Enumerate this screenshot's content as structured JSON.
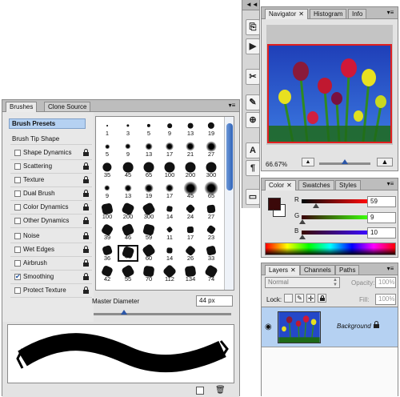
{
  "brushes_panel": {
    "tabs": [
      "Brushes",
      "Clone Source"
    ],
    "presets_label": "Brush Presets",
    "tip_shape_label": "Brush Tip Shape",
    "options": [
      {
        "label": "Shape Dynamics",
        "checked": false,
        "lock": true
      },
      {
        "label": "Scattering",
        "checked": false,
        "lock": true
      },
      {
        "label": "Texture",
        "checked": false,
        "lock": true
      },
      {
        "label": "Dual Brush",
        "checked": false,
        "lock": true
      },
      {
        "label": "Color Dynamics",
        "checked": false,
        "lock": true
      },
      {
        "label": "Other Dynamics",
        "checked": false,
        "lock": true
      },
      {
        "label": "Noise",
        "checked": false,
        "lock": true
      },
      {
        "label": "Wet Edges",
        "checked": false,
        "lock": true
      },
      {
        "label": "Airbrush",
        "checked": false,
        "lock": true
      },
      {
        "label": "Smoothing",
        "checked": true,
        "lock": true
      },
      {
        "label": "Protect Texture",
        "checked": false,
        "lock": true
      }
    ],
    "brush_sizes": [
      "1",
      "3",
      "5",
      "9",
      "13",
      "19",
      "5",
      "9",
      "13",
      "17",
      "21",
      "27",
      "35",
      "45",
      "65",
      "100",
      "200",
      "300",
      "9",
      "13",
      "19",
      "17",
      "45",
      "65",
      "100",
      "200",
      "300",
      "14",
      "24",
      "27",
      "39",
      "46",
      "59",
      "11",
      "17",
      "23",
      "36",
      "44",
      "60",
      "14",
      "26",
      "33",
      "42",
      "55",
      "70",
      "112",
      "134",
      "74"
    ],
    "selected_brush": "44",
    "master_diameter_label": "Master Diameter",
    "master_diameter_value": "44 px"
  },
  "navigator_panel": {
    "tabs": [
      "Navigator",
      "Histogram",
      "Info"
    ],
    "zoom": "66.67%"
  },
  "color_panel": {
    "tabs": [
      "Color",
      "Swatches",
      "Styles"
    ],
    "r_label": "R",
    "g_label": "G",
    "b_label": "B",
    "r_value": "59",
    "g_value": "9",
    "b_value": "10"
  },
  "layers_panel": {
    "tabs": [
      "Layers",
      "Channels",
      "Paths"
    ],
    "blend_mode": "Normal",
    "opacity_label": "Opacity:",
    "opacity_value": "100%",
    "lock_label": "Lock:",
    "fill_label": "Fill:",
    "fill_value": "100%",
    "layer_name": "Background"
  },
  "colors": {
    "foreground": "#3b090a",
    "selection": "#b5d1f2",
    "accent": "#2b56a8",
    "nav_view_box": "#e02020"
  },
  "icons": [
    "close-icon",
    "panel-menu-icon",
    "lock-icon",
    "eye-icon",
    "chain-icon",
    "trash-icon",
    "new-layer-icon",
    "mountain-small-icon",
    "mountain-large-icon"
  ]
}
